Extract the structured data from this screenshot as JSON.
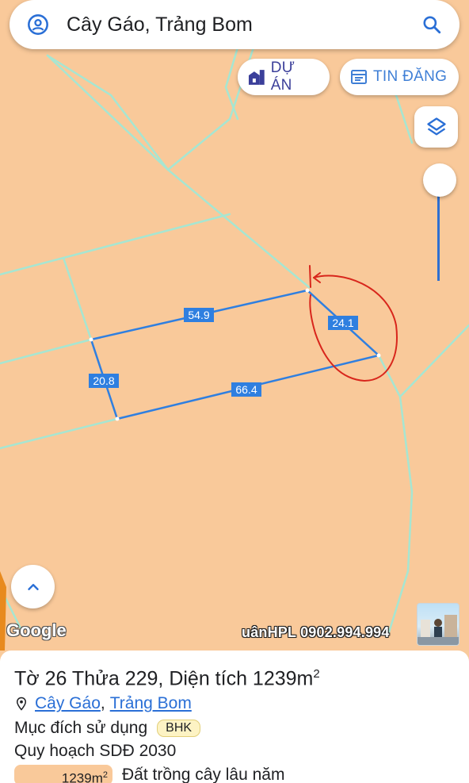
{
  "search": {
    "query": "Cây Gáo, Trảng Bom"
  },
  "chips": {
    "du_an": "DỰ ÁN",
    "tin_dang": "TIN ĐĂNG"
  },
  "map": {
    "edge_labels": [
      "54.9",
      "24.1",
      "20.8",
      "66.4"
    ],
    "google_logo": "Google",
    "watermark": "uânHPL 0902.994.994"
  },
  "plot": {
    "title_prefix": "Tờ ",
    "sheet_no": "26",
    "parcel_word": " Thửa ",
    "parcel_no": "229",
    "area_label": ", Diện tích ",
    "area": "1239m",
    "area_sup": "2",
    "commune": "Cây Gáo",
    "separator": ",",
    "district": "Trảng Bom",
    "purpose_label": "Mục đích sử dụng",
    "purpose_code": "BHK",
    "plan_label": "Quy hoạch SDĐ 2030",
    "plan_area": "1239m",
    "plan_area_sup": "2",
    "plan_use": "Đất trồng cây lâu năm"
  },
  "colors": {
    "map_bg": "#f9c99a",
    "parcel_line": "#2f7fe0",
    "boundary_line": "#9fe3d0",
    "annotation": "#d8261c"
  },
  "icons": [
    "location-icon",
    "search-icon",
    "building-icon",
    "listing-icon",
    "layers-icon",
    "chevron-up-icon",
    "pin-icon"
  ]
}
